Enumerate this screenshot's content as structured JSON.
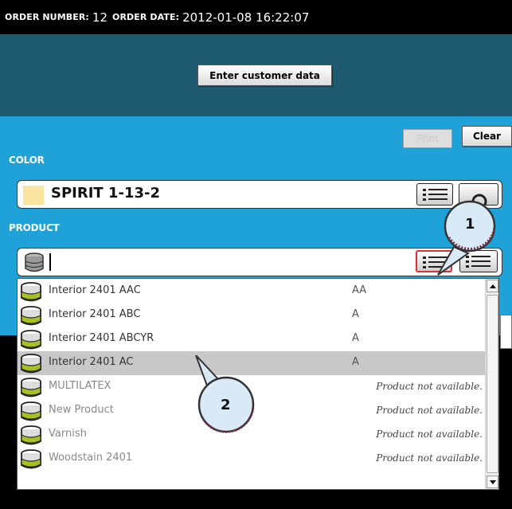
{
  "order": {
    "number_label": "ORDER NUMBER:",
    "number_value": "12",
    "date_label": "ORDER DATE:",
    "date_value": "2012-01-08 16:22:07"
  },
  "header": {
    "enter_customer_label": "Enter customer data"
  },
  "toolbar": {
    "print_label": "Print",
    "clear_label": "Clear"
  },
  "color": {
    "section_label": "COLOR",
    "value": "SPIRIT 1-13-2",
    "swatch_color": "#fbe3a0"
  },
  "product": {
    "section_label": "PRODUCT",
    "value": ""
  },
  "product_list": {
    "items": [
      {
        "name": "Interior 2401 AAC",
        "grade": "AA",
        "status": ""
      },
      {
        "name": "Interior 2401 ABC",
        "grade": "A",
        "status": ""
      },
      {
        "name": "Interior 2401 ABCYR",
        "grade": "A",
        "status": ""
      },
      {
        "name": "Interior 2401 AC",
        "grade": "A",
        "status": ""
      },
      {
        "name": "MULTILATEX",
        "grade": "",
        "status": "Product not available."
      },
      {
        "name": "New Product",
        "grade": "",
        "status": "Product not available."
      },
      {
        "name": "Varnish",
        "grade": "",
        "status": "Product not available."
      },
      {
        "name": "Woodstain 2401",
        "grade": "",
        "status": "Product not available."
      }
    ],
    "selected_index": 3
  },
  "callouts": {
    "one": "1",
    "two": "2"
  },
  "colors": {
    "header_band": "#1e5a70",
    "form_bg": "#1fa2d8",
    "callout_fill": "#d9eaf7",
    "highlight_border": "#e03030"
  }
}
